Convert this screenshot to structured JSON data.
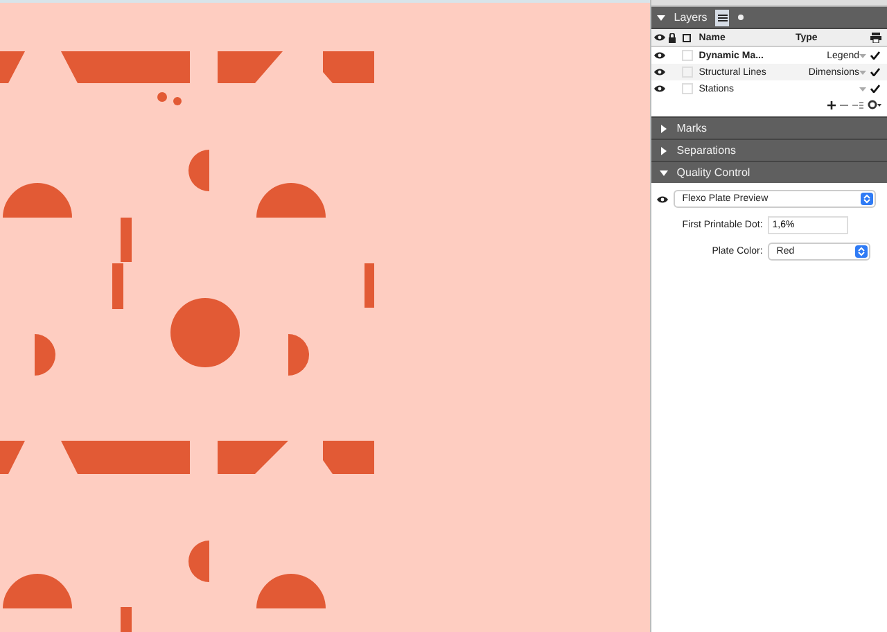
{
  "layers_panel": {
    "title": "Layers",
    "expanded": true,
    "columns": [
      "Name",
      "Type"
    ],
    "rows": [
      {
        "name": "Dynamic Ma...",
        "type": "Legend",
        "visible": true,
        "printable": true,
        "bold": true
      },
      {
        "name": "Structural Lines",
        "type": "Dimensions",
        "visible": true,
        "printable": true,
        "bold": false
      },
      {
        "name": "Stations",
        "type": "",
        "visible": true,
        "printable": true,
        "bold": false
      }
    ]
  },
  "sections": [
    {
      "title": "Marks",
      "expanded": false
    },
    {
      "title": "Separations",
      "expanded": false
    },
    {
      "title": "Quality Control",
      "expanded": true
    }
  ],
  "quality_control": {
    "preview": {
      "value": "Flexo Plate Preview",
      "visible": true
    },
    "first_printable_dot": {
      "label": "First Printable Dot:",
      "value": "1,6%"
    },
    "plate_color": {
      "label": "Plate Color:",
      "value": "Red"
    }
  }
}
